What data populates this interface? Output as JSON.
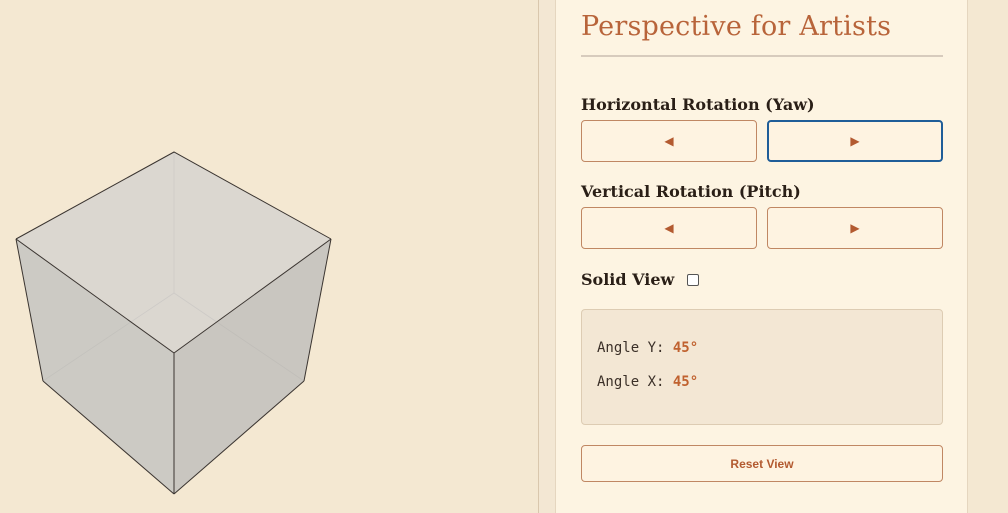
{
  "panel": {
    "title": "Perspective for Artists",
    "yaw_label": "Horizontal Rotation (Yaw)",
    "pitch_label": "Vertical Rotation (Pitch)",
    "left_glyph": "◀",
    "right_glyph": "▶",
    "solid_label": "Solid View",
    "solid_checked": false,
    "reset_label": "Reset View"
  },
  "info": {
    "angle_y_label": "Angle Y: ",
    "angle_y_value": "45°",
    "angle_x_label": "Angle X: ",
    "angle_x_value": "45°"
  },
  "colors": {
    "accent": "#b8643a",
    "background": "#f4e8d2",
    "panel": "#fdf4e2",
    "focus": "#1f5d98"
  }
}
